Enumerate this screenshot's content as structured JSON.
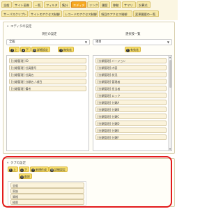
{
  "tabs_row1": [
    "全般",
    "サイト画像",
    "一覧",
    "フィルタ",
    "集計",
    "エディタ",
    "リンク",
    "履歴",
    "移動",
    "サマリ",
    "計算式"
  ],
  "active_tab": "エディタ",
  "tabs_row2": [
    "サーバスクリプト",
    "サイトのアクセス制御",
    "レコードのアクセス制御",
    "項目のアクセス制御",
    "変更履歴の一覧"
  ],
  "editor_section": {
    "title": "エディタの設定",
    "current_label": "現在の設定",
    "available_label": "選択肢一覧",
    "current_select": "全般",
    "available_select": "項目",
    "left_buttons": {
      "up": "上",
      "down": "下",
      "detail": "詳細設定",
      "disable": "無効化"
    },
    "right_button": "有効化",
    "current_items": [
      "[分類管理] ID",
      "[分類管理] 社員番号",
      "[分類管理] 社員名",
      "[分類管理] 分類名 / 項目",
      "[分類管理] 備考"
    ],
    "available_items": [
      "[分類管理] バージョン",
      "[分類管理] 内容",
      "[分類管理] 状況",
      "[分類管理] 管理者",
      "[分類管理] 担当者",
      "[分類管理] ロック",
      "[分類管理] 分類A",
      "[分類管理] 分類B",
      "[分類管理] 分類C",
      "[分類管理] 分類D",
      "[分類管理] 分類E",
      "[分類管理] 分類F"
    ]
  },
  "tab_section": {
    "title": "タブの設定",
    "buttons": {
      "up": "上",
      "down": "下",
      "create": "新規作成",
      "detail": "詳細設定",
      "delete": "削除"
    },
    "items": [
      "全般",
      "家族",
      "資格",
      "経歴"
    ]
  },
  "colors": {
    "active_tab": "#f6a81e",
    "button": "#f7de6a",
    "highlight": "#e31b1b"
  }
}
